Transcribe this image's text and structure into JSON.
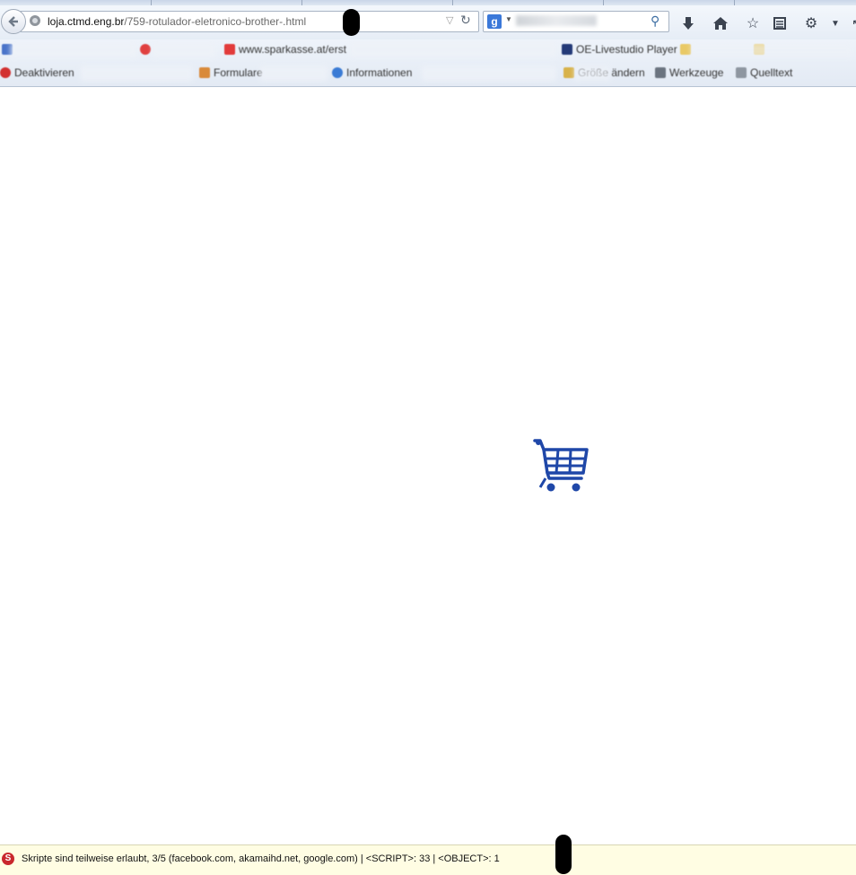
{
  "browser": {
    "url_host": "loja.ctmd.eng.br",
    "url_path": "/759-rotulador-eletronico-brother-.html",
    "search_engine_icon": "google-icon",
    "toolbar_icons": [
      "download-icon",
      "home-icon",
      "star-icon",
      "reader-icon",
      "addon-gear-icon",
      "menu-dropdown-icon"
    ]
  },
  "bookmarks_row1": [
    {
      "label": "",
      "icon": "bookmark-icon"
    },
    {
      "label": "",
      "icon": "bookmark-icon"
    },
    {
      "label": "www.sparkasse.at/erst",
      "icon": "sparkasse-icon"
    },
    {
      "label": "",
      "icon": "bookmark-icon"
    },
    {
      "label": "OE-Livestudio Player",
      "icon": "player-icon"
    },
    {
      "label": "",
      "icon": "folder-icon"
    },
    {
      "label": "",
      "icon": "folder-icon"
    }
  ],
  "bookmarks_row2": [
    {
      "label": "Deaktivieren",
      "icon": "webdev-icon"
    },
    {
      "label": "Formulare",
      "icon": "form-icon"
    },
    {
      "label": "Informationen",
      "icon": "info-icon"
    },
    {
      "label": "Größe ändern",
      "icon": "resize-icon"
    },
    {
      "label": "Werkzeuge",
      "icon": "tools-icon"
    },
    {
      "label": "Quelltext",
      "icon": "source-icon"
    }
  ],
  "page": {
    "center_icon": "shopping-cart-icon",
    "accent_color": "#1f47a8"
  },
  "status": {
    "text": "Skripte sind teilweise erlaubt, 3/5 (facebook.com, akamaihd.net, google.com) | <SCRIPT>: 33 | <OBJECT>: 1",
    "icon": "noscript-icon",
    "icon_color": "#c9282d"
  }
}
